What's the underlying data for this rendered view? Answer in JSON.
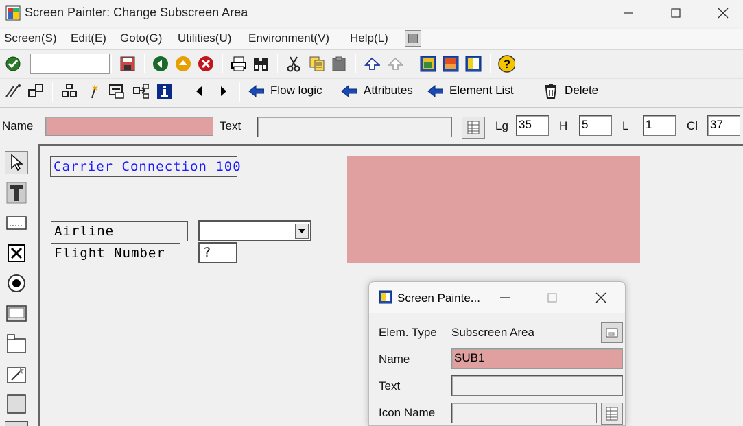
{
  "window": {
    "title": "Screen Painter:  Change Subscreen Area"
  },
  "menu": [
    "Screen(S)",
    "Edit(E)",
    "Goto(G)",
    "Utilities(U)",
    "Environment(V)",
    "Help(L)"
  ],
  "toolbar2": {
    "flow_logic": "Flow logic",
    "attributes": "Attributes",
    "element_list": "Element List",
    "delete": "Delete"
  },
  "fields": {
    "name_label": "Name",
    "name_value": "",
    "text_label": "Text",
    "text_value": "",
    "lg_label": "Lg",
    "lg_value": "35",
    "h_label": "H",
    "h_value": "5",
    "l_label": "L",
    "l_value": "1",
    "cl_label": "Cl",
    "cl_value": "37"
  },
  "canvas": {
    "title_box": "Carrier Connection 100",
    "airline_label": "Airline",
    "flight_label": "Flight Number",
    "flight_value": "?"
  },
  "dialog": {
    "title": "Screen Painte...",
    "elem_type_label": "Elem. Type",
    "elem_type_value": "Subscreen Area",
    "name_label": "Name",
    "name_value": "SUB1",
    "text_label": "Text",
    "text_value": "",
    "icon_name_label": "Icon Name",
    "icon_name_value": ""
  },
  "colors": {
    "highlight_pink": "#e0a0a0",
    "canvas_text_blue": "#1a1aff",
    "sap_blue": "#003c9e"
  },
  "icons": [
    "app-icon",
    "minimize-icon",
    "maximize-icon",
    "close-icon",
    "enter-check-icon",
    "save-icon",
    "back-icon",
    "exit-icon",
    "cancel-icon",
    "print-icon",
    "find-icon",
    "cut-icon",
    "copy-icon",
    "paste-icon",
    "undo-icon",
    "redo-icon",
    "help-icon"
  ]
}
